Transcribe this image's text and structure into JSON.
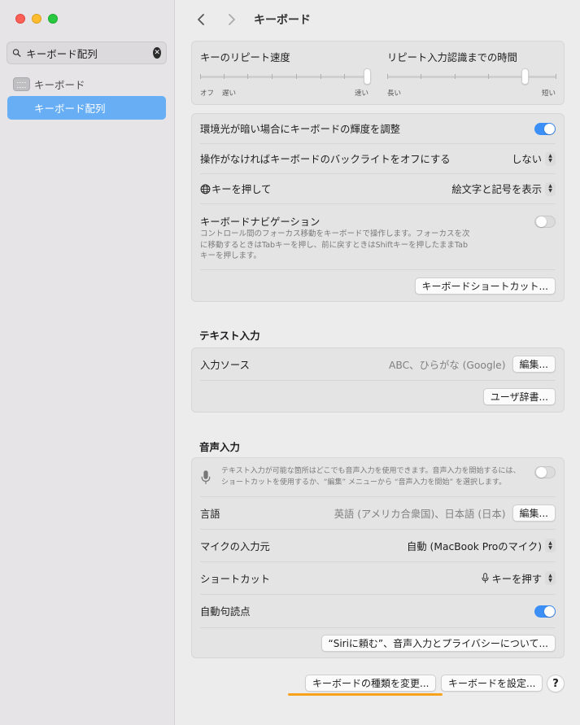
{
  "window": {
    "title": "キーボード",
    "colors": {
      "accent": "#3c8ff6",
      "sidebar_selected": "#67aef5",
      "underline": "#f7a21b"
    }
  },
  "sidebar": {
    "search_value": "キーボード配列",
    "items": [
      {
        "label": "キーボード",
        "icon": "keyboard-icon"
      },
      {
        "label": "キーボード配列"
      }
    ]
  },
  "repeat": {
    "speed_title": "キーのリピート速度",
    "speed_labels": [
      "オフ",
      "遅い",
      "速い"
    ],
    "speed_level": 1.0,
    "delay_title": "リピート入力認識までの時間",
    "delay_labels": [
      "長い",
      "短い"
    ],
    "delay_level": 0.83
  },
  "settings": {
    "ambient_light": {
      "label": "環境光が暗い場合にキーボードの輝度を調整",
      "on": true
    },
    "backlight_off": {
      "label": "操作がなければキーボードのバックライトをオフにする",
      "value": "しない"
    },
    "globe_key": {
      "label": "キーを押して",
      "value": "絵文字と記号を表示",
      "icon": "globe-icon"
    },
    "keyboard_nav": {
      "label": "キーボードナビゲーション",
      "desc_lines": [
        "コントロール間のフォーカス移動をキーボードで操作します。フォーカスを次",
        "に移動するときはTabキーを押し、前に戻すときはShiftキーを押したままTab",
        "キーを押します。"
      ],
      "on": false
    },
    "shortcuts_button": "キーボードショートカット..."
  },
  "text_input": {
    "section_title": "テキスト入力",
    "input_sources_label": "入力ソース",
    "input_sources_value": "ABC、ひらがな (Google)",
    "edit_button": "編集...",
    "user_dict_button": "ユーザ辞書..."
  },
  "voice_input": {
    "section_title": "音声入力",
    "desc_lines": [
      "テキスト入力が可能な箇所はどこでも音声入力を使用できます。音声入力を開始するには、",
      "ショートカットを使用するか、“編集” メニューから “音声入力を開始” を選択します。"
    ],
    "on": false,
    "language_label": "言語",
    "language_value": "英語 (アメリカ合衆国)、日本語 (日本)",
    "language_edit": "編集...",
    "mic_label": "マイクの入力元",
    "mic_value": "自動 (MacBook Proのマイク)",
    "shortcut_label": "ショートカット",
    "shortcut_value": "キーを押す",
    "auto_punct_label": "自動句読点",
    "auto_punct_on": true,
    "siri_button": "“Siriに頼む”、音声入力とプライバシーについて..."
  },
  "footer": {
    "change_type_button": "キーボードの種類を変更...",
    "setup_button": "キーボードを設定...",
    "help": "?"
  }
}
